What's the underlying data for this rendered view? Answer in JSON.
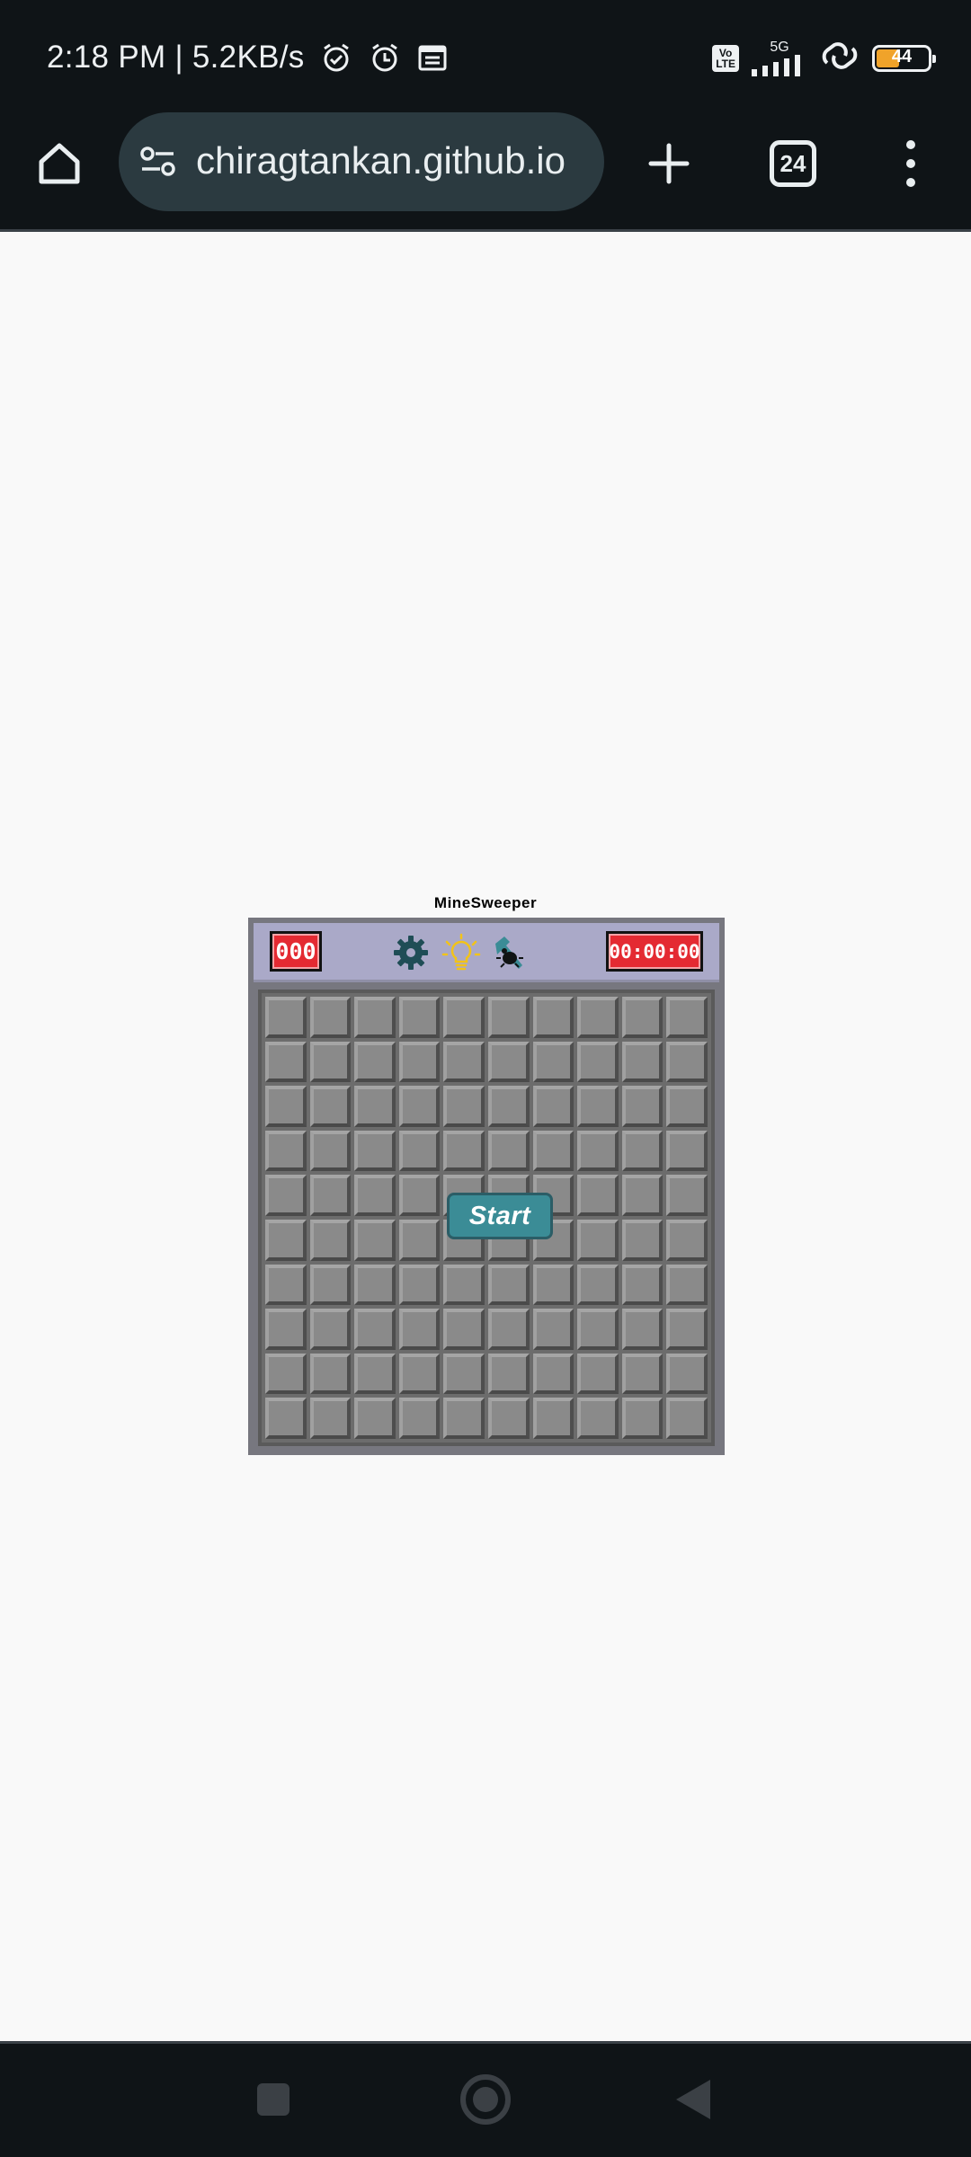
{
  "status_bar": {
    "time": "2:18 PM | 5.2KB/s",
    "battery_level": "44",
    "network": "5G",
    "volte": "Vo LTE"
  },
  "toolbar": {
    "url": "chiragtankan.github.io",
    "tab_count": "24"
  },
  "game": {
    "title": "MineSweeper",
    "mine_counter": "000",
    "timer": "00:00:00",
    "start_label": "Start",
    "rows": 10,
    "cols": 10
  },
  "colors": {
    "counter": "#e42a32",
    "header": "#aaa9c8",
    "start_button": "#3b8c96",
    "bulb": "#f2c318",
    "gear": "#1f4d56"
  }
}
